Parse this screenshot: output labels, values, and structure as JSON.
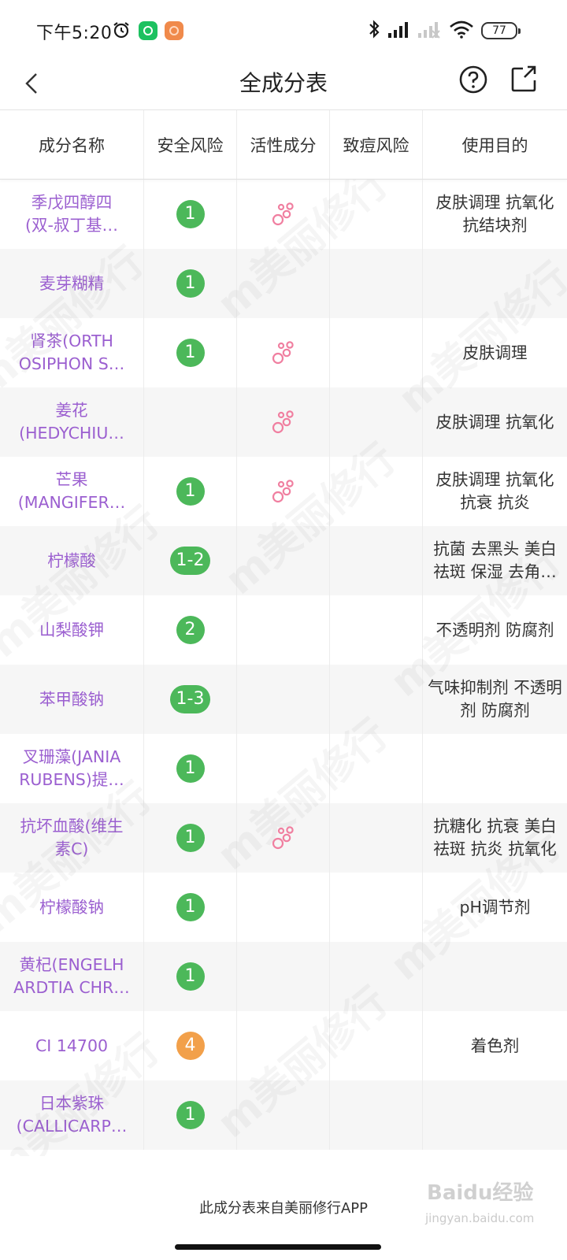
{
  "status_bar": {
    "time": "下午5:20",
    "battery": "77"
  },
  "nav": {
    "title": "全成分表"
  },
  "table": {
    "headers": [
      "成分名称",
      "安全风险",
      "活性成分",
      "致痘风险",
      "使用目的"
    ],
    "rows": [
      {
        "name_line1": "季戊四醇四",
        "name_line2": "(双-叔丁基…",
        "safety": "1",
        "safety_color": "#4cb85a",
        "active": true,
        "purpose_line1": "皮肤调理 抗氧化",
        "purpose_line2": "抗结块剂"
      },
      {
        "name_line1": "麦芽糊精",
        "name_line2": "",
        "safety": "1",
        "safety_color": "#4cb85a",
        "active": false,
        "purpose_line1": "",
        "purpose_line2": ""
      },
      {
        "name_line1": "肾茶(ORTH",
        "name_line2": "OSIPHON S…",
        "safety": "1",
        "safety_color": "#4cb85a",
        "active": true,
        "purpose_line1": "皮肤调理",
        "purpose_line2": ""
      },
      {
        "name_line1": "姜花",
        "name_line2": "(HEDYCHIU…",
        "safety": "",
        "safety_color": "#4cb85a",
        "active": true,
        "purpose_line1": "皮肤调理 抗氧化",
        "purpose_line2": ""
      },
      {
        "name_line1": "芒果",
        "name_line2": "(MANGIFER…",
        "safety": "1",
        "safety_color": "#4cb85a",
        "active": true,
        "purpose_line1": "皮肤调理 抗氧化",
        "purpose_line2": "抗衰 抗炎"
      },
      {
        "name_line1": "柠檬酸",
        "name_line2": "",
        "safety": "1-2",
        "safety_color": "#4cb85a",
        "active": false,
        "purpose_line1": "抗菌 去黑头 美白",
        "purpose_line2": "祛斑 保湿 去角…"
      },
      {
        "name_line1": "山梨酸钾",
        "name_line2": "",
        "safety": "2",
        "safety_color": "#4cb85a",
        "active": false,
        "purpose_line1": "不透明剂 防腐剂",
        "purpose_line2": ""
      },
      {
        "name_line1": "苯甲酸钠",
        "name_line2": "",
        "safety": "1-3",
        "safety_color": "#4cb85a",
        "active": false,
        "purpose_line1": "气味抑制剂 不透明",
        "purpose_line2": "剂 防腐剂"
      },
      {
        "name_line1": "叉珊藻(JANIA",
        "name_line2": "RUBENS)提…",
        "safety": "1",
        "safety_color": "#4cb85a",
        "active": false,
        "purpose_line1": "",
        "purpose_line2": ""
      },
      {
        "name_line1": "抗坏血酸(维生",
        "name_line2": "素C)",
        "safety": "1",
        "safety_color": "#4cb85a",
        "active": true,
        "purpose_line1": "抗糖化 抗衰 美白",
        "purpose_line2": "祛斑 抗炎 抗氧化"
      },
      {
        "name_line1": "柠檬酸钠",
        "name_line2": "",
        "safety": "1",
        "safety_color": "#4cb85a",
        "active": false,
        "purpose_line1": "pH调节剂",
        "purpose_line2": ""
      },
      {
        "name_line1": "黄杞(ENGELH",
        "name_line2": "ARDTIA CHR…",
        "safety": "1",
        "safety_color": "#4cb85a",
        "active": false,
        "purpose_line1": "",
        "purpose_line2": ""
      },
      {
        "name_line1": "CI 14700",
        "name_line2": "",
        "safety": "4",
        "safety_color": "#f2a04a",
        "active": false,
        "purpose_line1": "着色剂",
        "purpose_line2": ""
      },
      {
        "name_line1": "日本紫珠",
        "name_line2": "(CALLICARP…",
        "safety": "1",
        "safety_color": "#4cb85a",
        "active": false,
        "purpose_line1": "",
        "purpose_line2": ""
      }
    ]
  },
  "footer": {
    "note": "此成分表来自美丽修行APP"
  },
  "watermarks": {
    "app_mark": "m美丽修行",
    "baidu_logo": "Baidu经验",
    "baidu_sub": "jingyan.baidu.com"
  },
  "colors": {
    "ingredient_name": "#9b5fd0",
    "safety_green": "#4cb85a",
    "safety_orange": "#f2a04a",
    "active_icon": "#f07fa0"
  }
}
